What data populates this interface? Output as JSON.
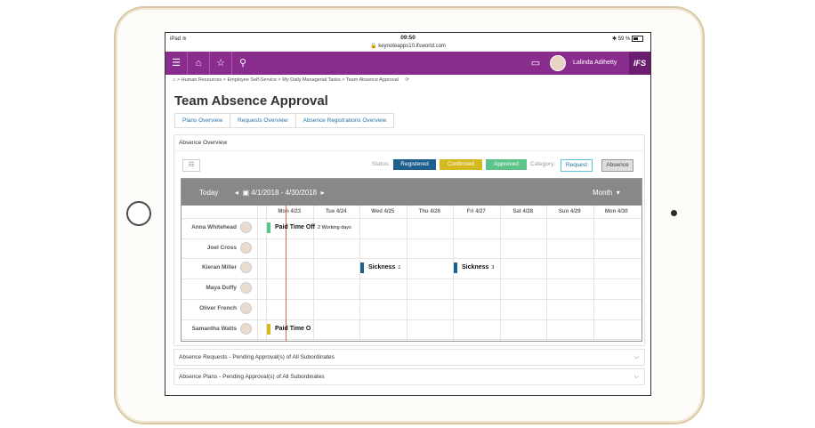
{
  "status_bar": {
    "device": "iPad",
    "wifi": "wifi-icon",
    "time": "09:50",
    "url": "keynoteapps10.ifsworld.com",
    "bluetooth": "bluetooth-icon",
    "battery": "59 %"
  },
  "topbar": {
    "user_name": "Lalinda Adihetty",
    "brand": "IFS",
    "color": "#8a2b8e"
  },
  "breadcrumb": {
    "items": [
      "Human Resources",
      "Employee Self-Service",
      "My Daily Managerial Tasks",
      "Team Absence Approval"
    ],
    "separator": ">"
  },
  "page_title": "Team Absence Approval",
  "tabs": [
    "Plans Overview",
    "Requests Overview",
    "Absence Registrations Overview"
  ],
  "absence_overview": {
    "title": "Absence Overview",
    "status_label": "Status:",
    "category_label": "Category:",
    "statuses": [
      {
        "label": "Registered",
        "color": "#1f5f8b"
      },
      {
        "label": "Confirmed",
        "color": "#d4b91f"
      },
      {
        "label": "Approved",
        "color": "#5cc48a"
      }
    ],
    "categories": [
      {
        "label": "Request",
        "selected": false
      },
      {
        "label": "Absence",
        "selected": true
      }
    ]
  },
  "calendar": {
    "today_label": "Today",
    "range": "4/1/2018 - 4/30/2018",
    "view": "Month",
    "days": [
      "Mon 4/23",
      "Tue 4/24",
      "Wed 4/25",
      "Thu 4/26",
      "Fri 4/27",
      "Sat 4/28",
      "Sun 4/29",
      "Mon 4/30"
    ],
    "employees": [
      "Anna Whitehead",
      "Joel Cross",
      "Kieran Miller",
      "Maya Duffy",
      "Oliver French",
      "Samantha Watts"
    ],
    "events": [
      {
        "row": 0,
        "label": "Paid Time Off",
        "duration": "2 Working days",
        "color": "#5cc48a"
      },
      {
        "row": 2,
        "label": "Sickness",
        "duration": "1",
        "color": "#1f5f8b"
      },
      {
        "row": 2,
        "label": "Sickness",
        "duration": "3",
        "color": "#1f5f8b"
      },
      {
        "row": 5,
        "label": "Paid Time O",
        "duration": "",
        "color": "#d4b91f"
      }
    ]
  },
  "accordions": [
    "Absence Requests - Pending Approval(s) of All Subordinates",
    "Absence Plans - Pending Approval(s) of All Subordinates"
  ]
}
